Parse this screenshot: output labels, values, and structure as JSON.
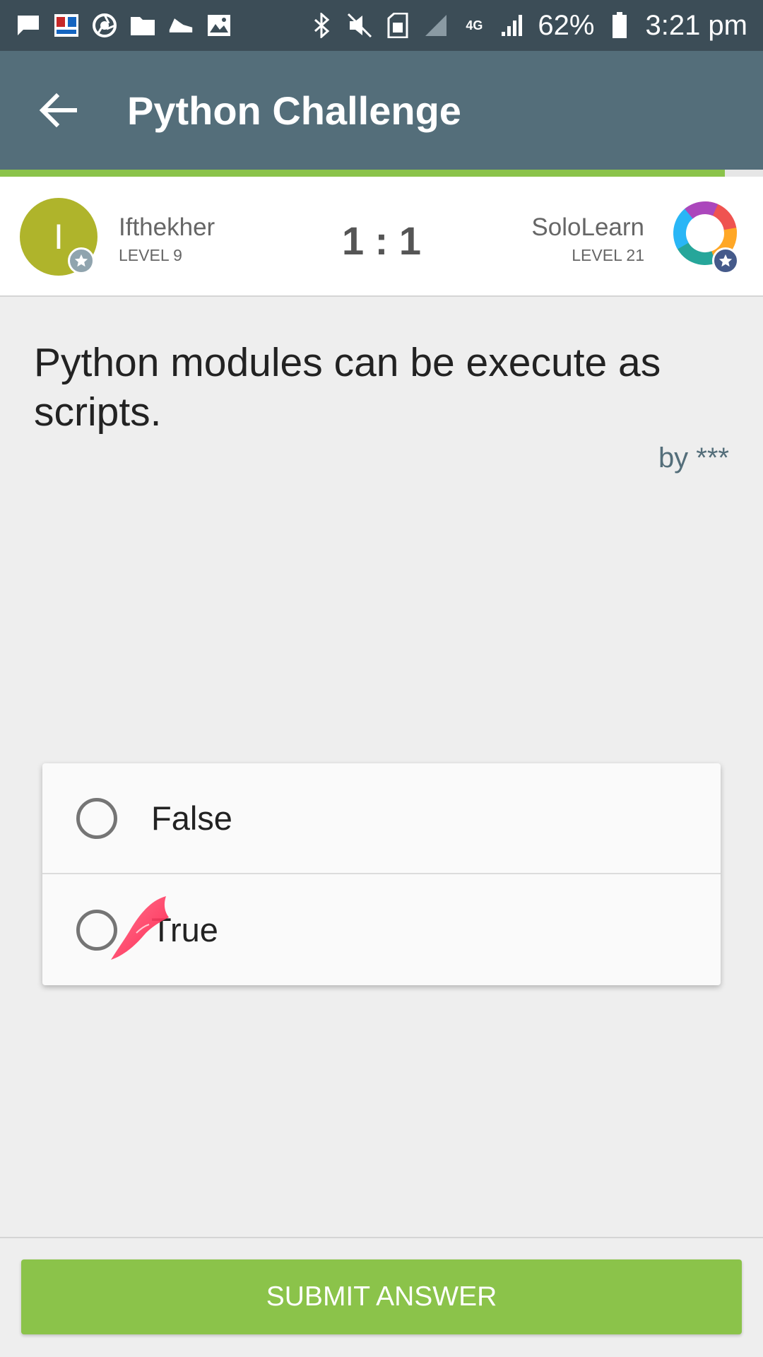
{
  "status_bar": {
    "battery_percent": "62%",
    "time": "3:21 pm",
    "network": "4G",
    "icons_left": [
      "message-icon",
      "bookmark-app-icon",
      "aperture-icon",
      "folder-icon",
      "shoe-icon",
      "image-icon"
    ],
    "icons_right": [
      "bluetooth-icon",
      "mute-icon",
      "sim-icon",
      "signal-icon",
      "data-4g-icon",
      "signal-bars-icon",
      "battery-icon"
    ]
  },
  "app_bar": {
    "title": "Python Challenge",
    "back_icon": "arrow-back-icon"
  },
  "progress": {
    "fraction": 0.95,
    "color": "#8bc34a"
  },
  "players": {
    "left": {
      "initial": "I",
      "name": "Ifthekher",
      "level": "LEVEL 9",
      "avatar_color": "#afb42b"
    },
    "right": {
      "name": "SoloLearn",
      "level": "LEVEL 21"
    },
    "score": "1 : 1"
  },
  "question": {
    "text": "Python modules can be execute as scripts.",
    "author": "by ***"
  },
  "options": [
    {
      "label": "False",
      "selected": false
    },
    {
      "label": "True",
      "selected": false
    }
  ],
  "submit": {
    "label": "SUBMIT ANSWER",
    "color": "#8bc34a"
  },
  "colors": {
    "status_bar": "#3c4d57",
    "app_bar": "#546e7a",
    "background": "#eeeeee"
  }
}
